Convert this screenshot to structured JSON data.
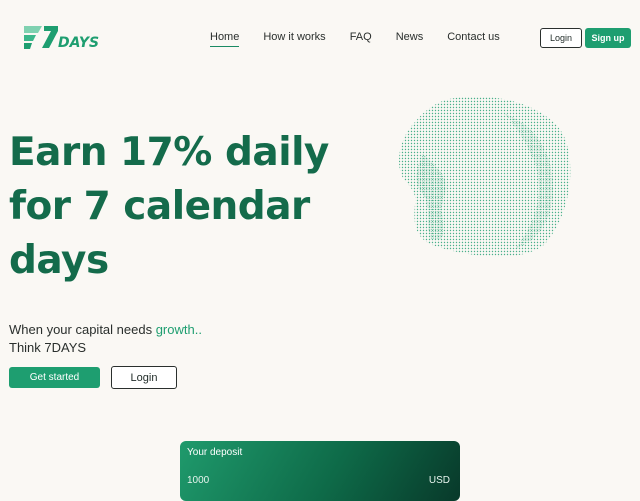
{
  "brand": {
    "logo_text": "7DAYS",
    "color": "#1e9e70",
    "dark": "#146b4b"
  },
  "nav": {
    "items": [
      {
        "label": "Home",
        "active": true
      },
      {
        "label": "How it works"
      },
      {
        "label": "FAQ"
      },
      {
        "label": "News"
      },
      {
        "label": "Contact us"
      }
    ],
    "login_label": "Login",
    "signup_label": "Sign up"
  },
  "hero": {
    "headline_line1": "Earn 17% daily",
    "headline_line2": "for 7 calendar",
    "headline_line3": "days",
    "tagline_prefix": "When your capital needs ",
    "tagline_accent": "growth..",
    "tagline_line2": "Think 7DAYS",
    "cta_primary": "Get started",
    "cta_secondary": "Login"
  },
  "deposit": {
    "title": "Your deposit",
    "amount": "1000",
    "currency": "USD"
  },
  "icons": {
    "logo": "7days-logo-icon",
    "blob": "dotted-3d-blob-illustration"
  }
}
